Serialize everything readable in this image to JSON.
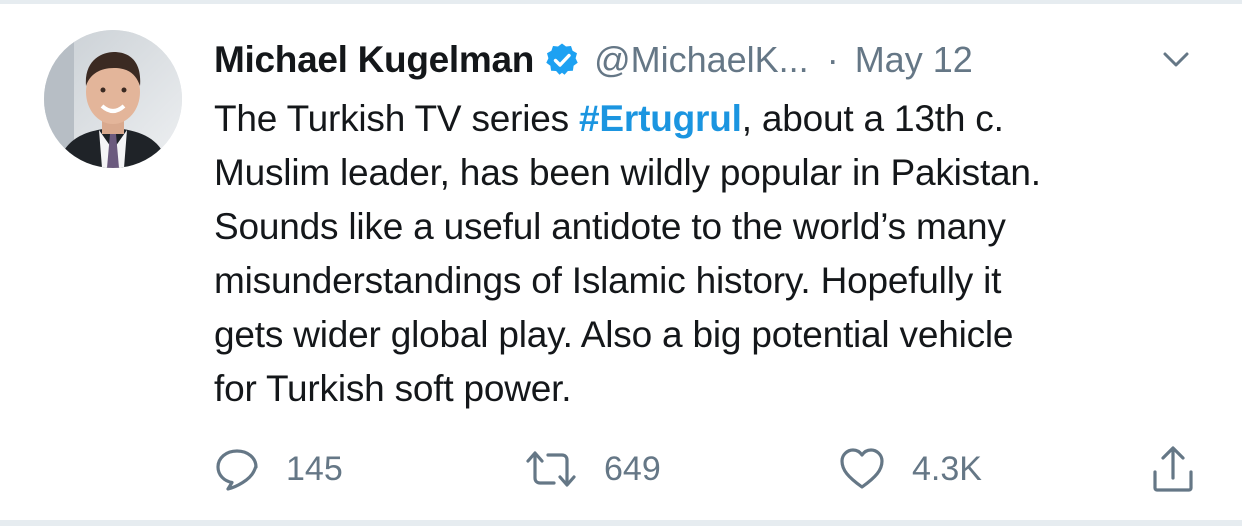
{
  "tweet": {
    "author_name": "Michael Kugelman",
    "handle": "@MichaelK...",
    "separator": "·",
    "date": "May 12",
    "text_lines": [
      {
        "before": "The Turkish TV series ",
        "hashtag": "#Ertugrul",
        "after": ", about a 13th c."
      },
      {
        "text": "Muslim leader, has been wildly popular in Pakistan."
      },
      {
        "text": "Sounds like a useful antidote to the world’s many"
      },
      {
        "text": "misunderstandings of Islamic history. Hopefully it"
      },
      {
        "text": "gets wider global play. Also a big potential vehicle"
      },
      {
        "text": "for Turkish soft power."
      }
    ]
  },
  "actions": {
    "reply_count": "145",
    "retweet_count": "649",
    "like_count": "4.3K"
  },
  "icons": {
    "verified": "verified-badge-icon",
    "menu": "chevron-down-icon",
    "reply": "reply-icon",
    "retweet": "retweet-icon",
    "like": "heart-icon",
    "share": "share-icon"
  },
  "colors": {
    "text": "#14171a",
    "secondary": "#657786",
    "link": "#1b95e0",
    "verified": "#1da1f2",
    "divider": "#e6ecf0"
  }
}
